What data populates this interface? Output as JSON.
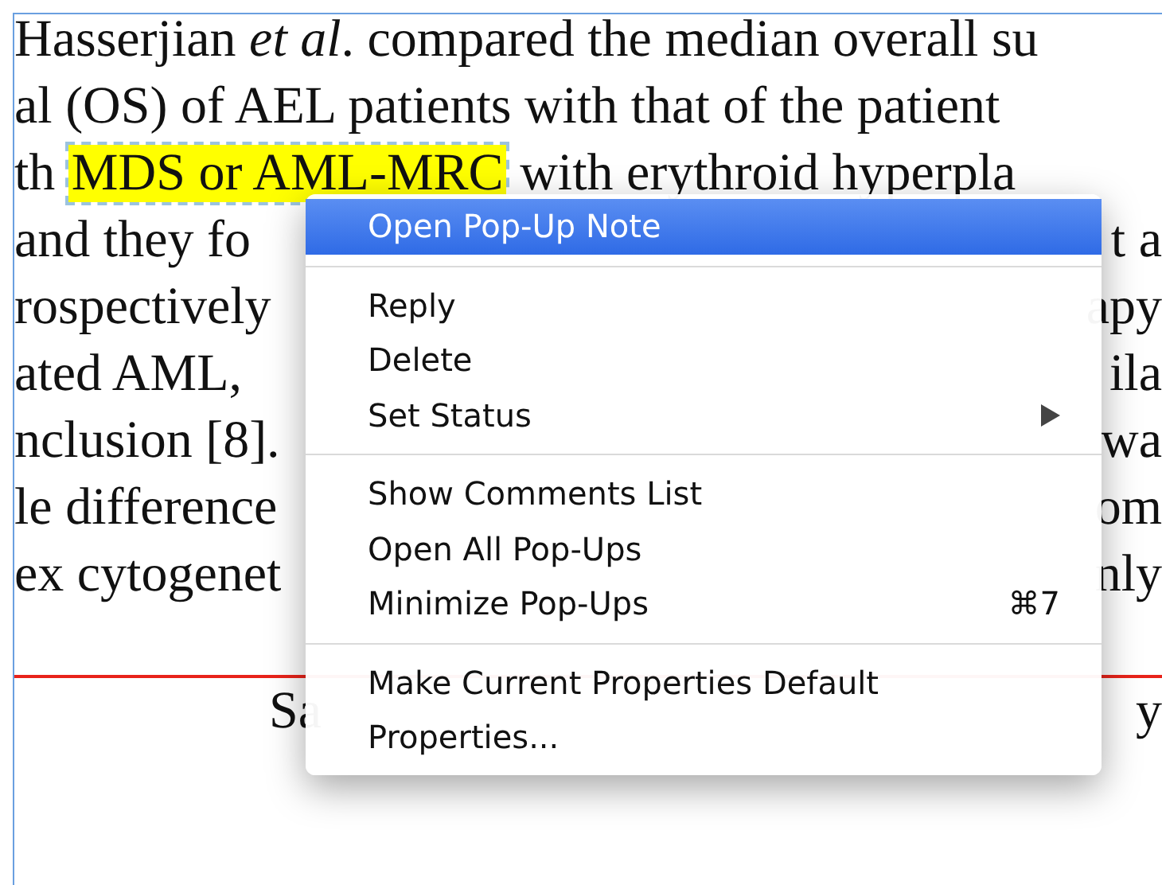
{
  "document": {
    "lines": [
      {
        "left": "Hasserjian *et al*. compared the median overall su"
      },
      {
        "left": "al (OS) of AEL patients with that of the patient"
      },
      {
        "left": "th",
        "highlight": "MDS or AML-MRC",
        "after": "with erythroid hyperpla"
      },
      {
        "left": "and they fo",
        "right": "t a"
      },
      {
        "left": "rospectively",
        "right": "apy"
      },
      {
        "left": "ated AML,",
        "right": "ila"
      },
      {
        "left": "nclusion [8].",
        "right": "wa"
      },
      {
        "left": "le difference",
        "right": "om"
      },
      {
        "left": "ex cytogenet",
        "right": "nly"
      }
    ],
    "footer": {
      "left": "Sa",
      "right": "y"
    }
  },
  "context_menu": {
    "items": [
      {
        "kind": "item",
        "label": "Open Pop-Up Note",
        "selected": true
      },
      {
        "kind": "separator"
      },
      {
        "kind": "item",
        "label": "Reply",
        "selected": false
      },
      {
        "kind": "item",
        "label": "Delete",
        "selected": false
      },
      {
        "kind": "item",
        "label": "Set Status",
        "selected": false,
        "submenu": true
      },
      {
        "kind": "separator"
      },
      {
        "kind": "item",
        "label": "Show Comments List",
        "selected": false
      },
      {
        "kind": "item",
        "label": "Open All Pop-Ups",
        "selected": false
      },
      {
        "kind": "item",
        "label": "Minimize Pop-Ups",
        "selected": false,
        "shortcut": "⌘7"
      },
      {
        "kind": "separator"
      },
      {
        "kind": "item",
        "label": "Make Current Properties Default",
        "selected": false
      },
      {
        "kind": "item",
        "label": "Properties...",
        "selected": false
      }
    ]
  }
}
